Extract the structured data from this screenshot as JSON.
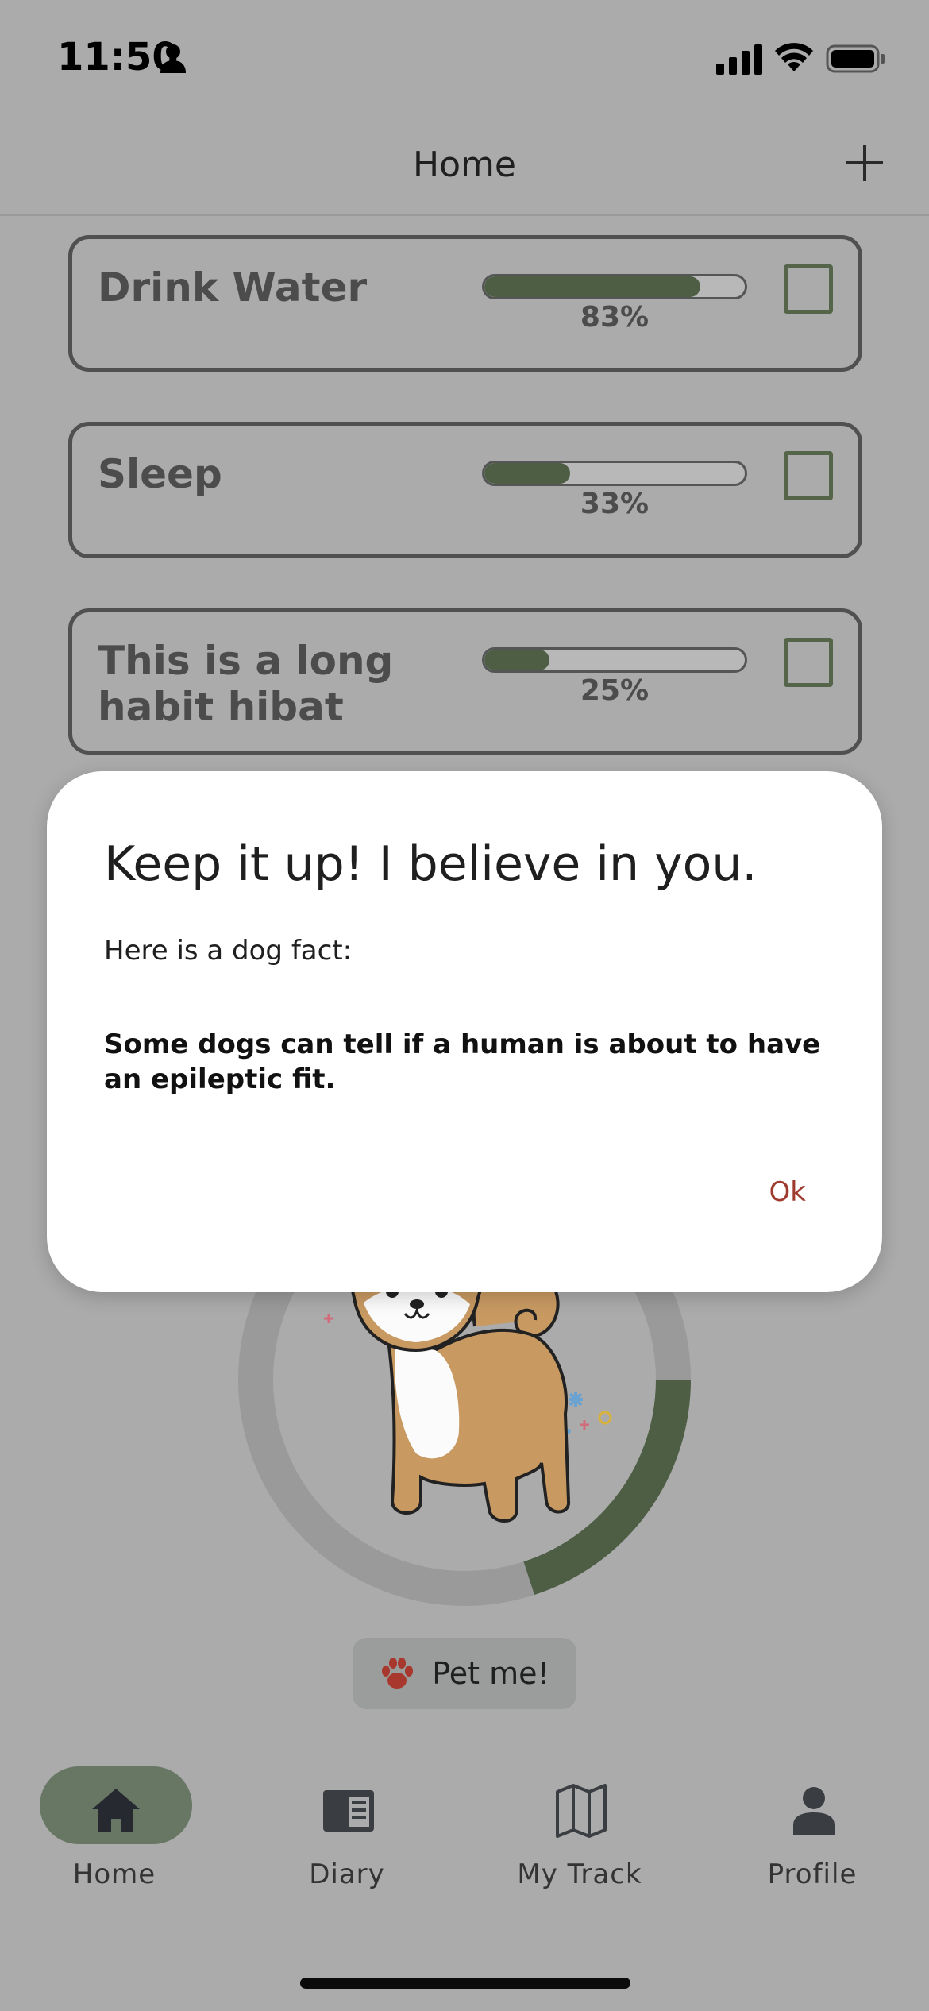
{
  "status_bar": {
    "time": "11:50"
  },
  "header": {
    "title": "Home"
  },
  "habits": [
    {
      "name": "Drink Water",
      "progress": 0.83,
      "progress_label": "83%",
      "checked": false
    },
    {
      "name": "Sleep",
      "progress": 0.33,
      "progress_label": "33%",
      "checked": false
    },
    {
      "name": "This is a long habit hibat",
      "progress": 0.25,
      "progress_label": "25%",
      "checked": false
    }
  ],
  "pet": {
    "button_label": "Pet me!",
    "happiness": 0.2
  },
  "dialog": {
    "title": "Keep it up! I believe in you.",
    "intro": "Here is a dog fact:",
    "fact": "Some dogs can tell if a human is about to have an epileptic fit.",
    "ok_label": "Ok"
  },
  "nav": {
    "items": [
      {
        "label": "Home",
        "icon": "home-icon",
        "active": true
      },
      {
        "label": "Diary",
        "icon": "diary-icon",
        "active": false
      },
      {
        "label": "My Track",
        "icon": "map-icon",
        "active": false
      },
      {
        "label": "Profile",
        "icon": "person-icon",
        "active": false
      }
    ]
  },
  "colors": {
    "accent": "#4d5e44",
    "overlay": "#ababab",
    "ok_text": "#9e3a2e",
    "nav_active_pill": "#687764"
  }
}
